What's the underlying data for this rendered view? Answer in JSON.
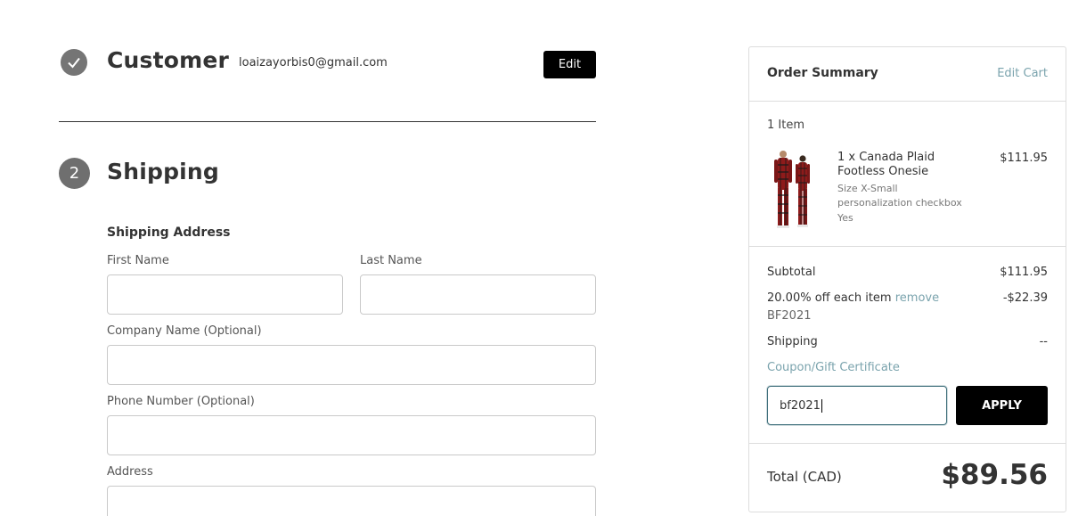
{
  "customer": {
    "step_icon": "check-icon",
    "title": "Customer",
    "email": "loaizayorbis0@gmail.com",
    "edit_label": "Edit"
  },
  "shipping": {
    "step_number": "2",
    "title": "Shipping",
    "section_title": "Shipping Address",
    "fields": {
      "first_name": {
        "label": "First Name",
        "value": ""
      },
      "last_name": {
        "label": "Last Name",
        "value": ""
      },
      "company": {
        "label": "Company Name (Optional)",
        "value": ""
      },
      "phone": {
        "label": "Phone Number (Optional)",
        "value": ""
      },
      "address": {
        "label": "Address",
        "value": ""
      }
    }
  },
  "summary": {
    "title": "Order Summary",
    "edit_cart": "Edit Cart",
    "item_count": "1 Item",
    "item": {
      "name": "1 x Canada Plaid Footless Onesie",
      "price": "$111.95",
      "options": [
        "Size X-Small",
        "personalization checkbox",
        "Yes"
      ]
    },
    "subtotal_label": "Subtotal",
    "subtotal_value": "$111.95",
    "discount_label": "20.00% off each item",
    "discount_remove": "remove",
    "discount_value": "-$22.39",
    "discount_code": "BF2021",
    "shipping_label": "Shipping",
    "shipping_value": "--",
    "coupon_link": "Coupon/Gift Certificate",
    "coupon_input_value": "bf2021",
    "apply_label": "APPLY",
    "total_label": "Total (CAD)",
    "total_value": "$89.56"
  },
  "colors": {
    "accent_link": "#7aa3ad",
    "button_bg": "#000000",
    "step_circle": "#757575"
  }
}
